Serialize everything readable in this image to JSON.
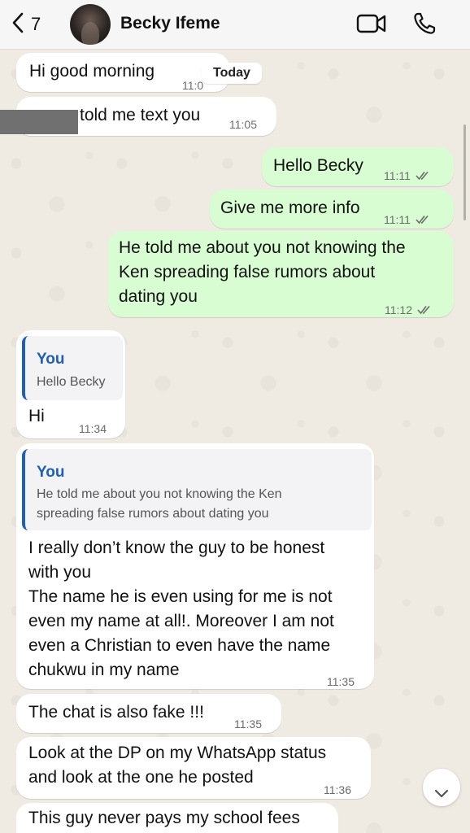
{
  "header": {
    "back_count": "7",
    "contact_name": "Becky Ifeme"
  },
  "chat": {
    "date_pill": "Today",
    "messages": [
      {
        "id": "m1",
        "direction": "incoming",
        "text": "Hi good morning",
        "time": "11:0"
      },
      {
        "id": "m2",
        "direction": "incoming",
        "text": "told me text you",
        "time": "11:05",
        "redacted_prefix": true
      },
      {
        "id": "m3",
        "direction": "outgoing",
        "text": "Hello Becky",
        "time": "11:11",
        "status": "read"
      },
      {
        "id": "m4",
        "direction": "outgoing",
        "text": "Give me more info",
        "time": "11:11",
        "status": "read"
      },
      {
        "id": "m5",
        "direction": "outgoing",
        "lines": [
          "He told me about you not knowing the",
          "Ken spreading false rumors about",
          "dating you"
        ],
        "time": "11:12",
        "status": "read"
      },
      {
        "id": "m6",
        "direction": "incoming",
        "quote": {
          "author": "You",
          "text": "Hello Becky"
        },
        "text": "Hi",
        "time": "11:34"
      },
      {
        "id": "m7",
        "direction": "incoming",
        "quote": {
          "author": "You",
          "lines": [
            "He told me about you not knowing the Ken",
            "spreading false rumors about dating you"
          ]
        },
        "lines": [
          "I really don’t know the guy to be honest",
          "with you",
          "The name he is even using for me is not",
          "even my name at all!. Moreover I am not",
          "even a Christian to even have the name",
          "chukwu in my name"
        ],
        "time": "11:35"
      },
      {
        "id": "m8",
        "direction": "incoming",
        "text": "The chat is also fake !!!",
        "time": "11:35"
      },
      {
        "id": "m9",
        "direction": "incoming",
        "lines": [
          "Look at the DP on my WhatsApp status",
          "and look at the one he posted"
        ],
        "time": "11:36"
      },
      {
        "id": "m10",
        "direction": "incoming",
        "text": "This guy never pays my school fees"
      }
    ]
  },
  "colors": {
    "incoming_bubble": "#ffffff",
    "outgoing_bubble": "#d9fdd3",
    "chat_background": "#efeae2",
    "quote_accent": "#1e60b4",
    "read_ticks": "#6b6b6b"
  },
  "icons": {
    "back": "chevron-left-icon",
    "video": "video-camera-icon",
    "call": "phone-icon",
    "read_status": "double-check-icon",
    "scroll": "chevron-down-icon"
  }
}
